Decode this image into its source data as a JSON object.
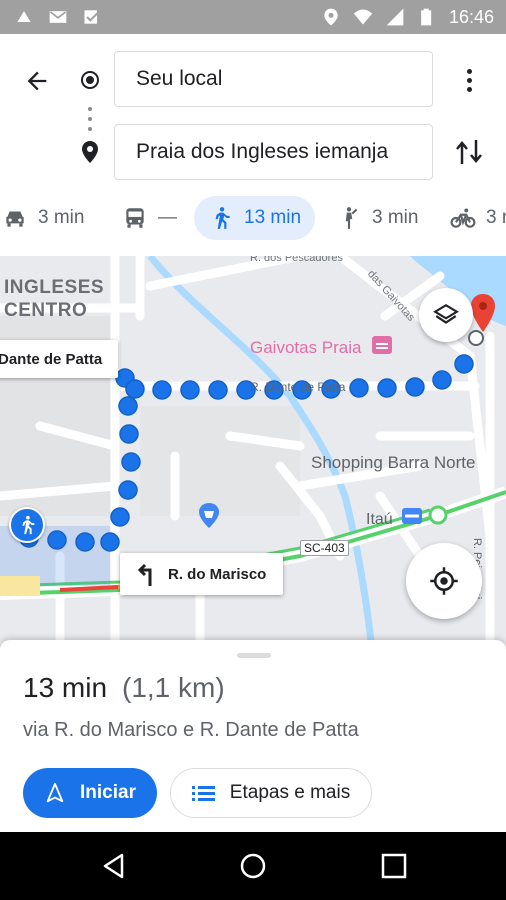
{
  "status_bar": {
    "time": "16:46",
    "left_icons": [
      "cloud-upload-icon",
      "gmail-icon",
      "checklist-icon"
    ],
    "right_icons": [
      "location-icon",
      "wifi-icon",
      "signal-icon",
      "battery-icon"
    ]
  },
  "directions": {
    "origin": "Seu local",
    "destination": "Praia dos Ingleses iemanja"
  },
  "travel_modes": [
    {
      "mode": "driving",
      "icon": "car-icon",
      "time": "3 min"
    },
    {
      "mode": "transit",
      "icon": "bus-icon",
      "time": "—"
    },
    {
      "mode": "walking",
      "icon": "walking-icon",
      "time": "13 min",
      "selected": true
    },
    {
      "mode": "ride",
      "icon": "ride-hailing-icon",
      "time": "3 min"
    },
    {
      "mode": "cycling",
      "icon": "bicycle-icon",
      "time": "3 r"
    }
  ],
  "map": {
    "area_label_line1": "INGLESES",
    "area_label_line2": "CENTRO",
    "street_pescadores": "R. dos Pescadores",
    "street_gaivotas": "das Gaivotas",
    "hotel": "Gaivotas Praia",
    "street_dante": "R. Dante de Patta",
    "callout_dante": "Dante de Patta",
    "mall": "Shopping Barra Norte",
    "bank": "Itaú",
    "highway": "SC-403",
    "street_peixe_rei": "R. Peixe Rei",
    "turn_callout": "R. do Marisco",
    "route_color": "#1a73e8",
    "destination_pin_color": "#ea4335"
  },
  "summary": {
    "duration": "13 min",
    "distance": "(1,1 km)",
    "via": "via R. do Marisco e R. Dante de Patta",
    "start_label": "Iniciar",
    "steps_label": "Etapas e mais"
  },
  "nav_bar": {
    "buttons": [
      "back-icon",
      "home-icon",
      "recent-apps-icon"
    ]
  }
}
